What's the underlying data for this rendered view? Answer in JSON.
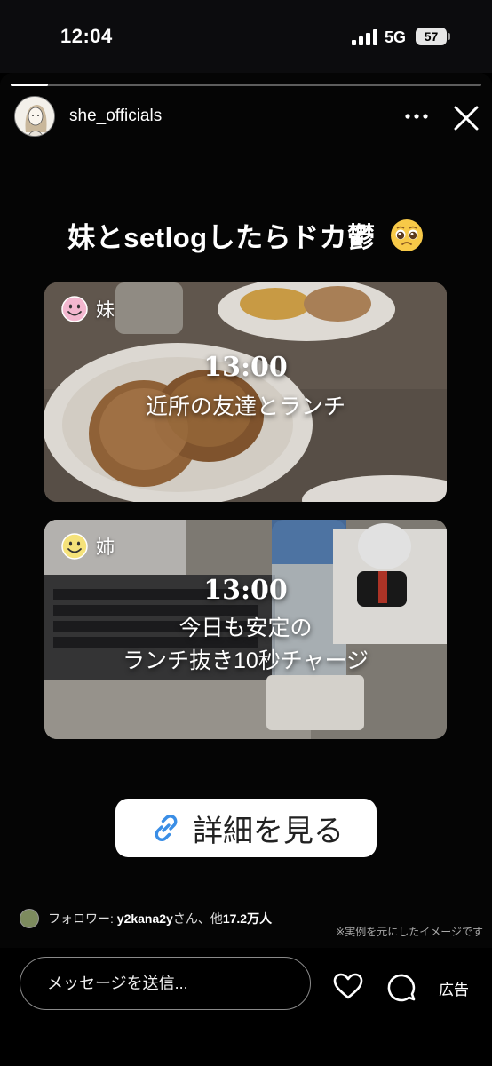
{
  "status_bar": {
    "time": "12:04",
    "network": "5G",
    "battery": "57"
  },
  "story": {
    "progress": 0.08,
    "username": "she_officials",
    "headline": "妹とsetlogしたらドカ鬱",
    "headline_emoji": "pleading-face-icon",
    "panels": [
      {
        "tag": "妹",
        "tag_icon": "smiley-icon-pink",
        "time": "13:00",
        "caption_lines": [
          "近所の友達とランチ"
        ]
      },
      {
        "tag": "姉",
        "tag_icon": "smiley-icon-yellow",
        "time": "13:00",
        "caption_lines": [
          "今日も安定の",
          "ランチ抜き10秒チャージ"
        ]
      }
    ],
    "cta_label": "詳細を見る"
  },
  "followers": {
    "prefix": "フォロワー: ",
    "name": "y2kana2y",
    "suffix": "さん、他",
    "count": "17.2万人"
  },
  "disclaimer": "※実例を元にしたイメージです",
  "bottom_bar": {
    "message_placeholder": "メッセージを送信...",
    "ad_label": "広告"
  },
  "colors": {
    "link_icon": "#3a8ee6",
    "smiley_pink": "#f3b7cf",
    "smiley_yellow": "#f5e27a"
  }
}
